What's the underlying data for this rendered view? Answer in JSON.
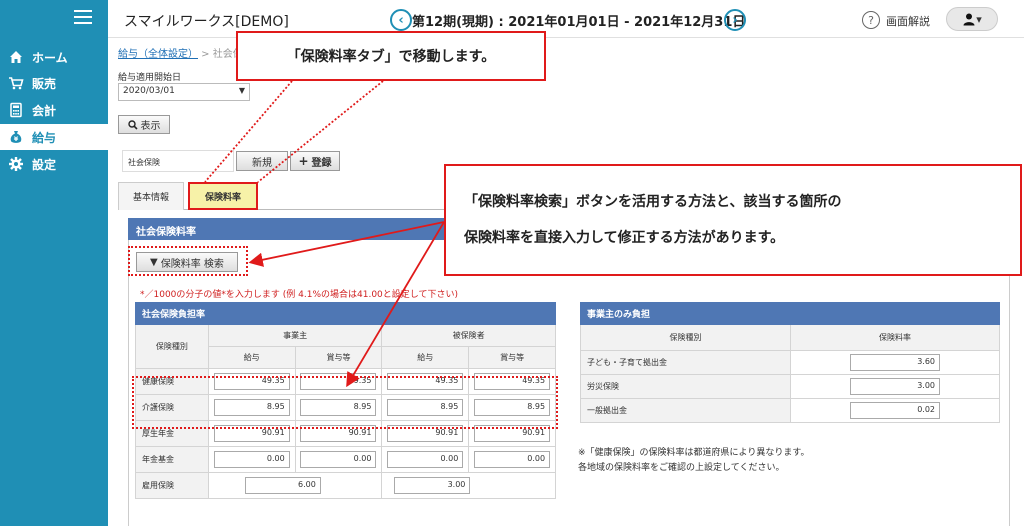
{
  "sidebar": {
    "items": [
      {
        "label": "ホーム",
        "icon": "home-icon"
      },
      {
        "label": "販売",
        "icon": "cart-icon"
      },
      {
        "label": "会計",
        "icon": "calculator-icon"
      },
      {
        "label": "給与",
        "icon": "money-bag-icon"
      },
      {
        "label": "設定",
        "icon": "gear-icon"
      }
    ],
    "active": "給与"
  },
  "header": {
    "company": "スマイルワークス[DEMO]",
    "period": "第12期(現期) : 2021年01月01日 - 2021年12月31日",
    "help_label": "画面解説"
  },
  "breadcrumb": {
    "link": "給与（全体設定）",
    "sep": " > ",
    "current": "社会保"
  },
  "filters": {
    "date_label": "給与適用開始日",
    "date_value": "2020/03/01",
    "show_button": "表示",
    "insurance_label": "社会保険",
    "new_button": "新規",
    "register_button": "登録"
  },
  "tabs": [
    {
      "label": "基本情報"
    },
    {
      "label": "保険料率"
    }
  ],
  "panel": {
    "title": "社会保険料率",
    "search_button": "保険料率 検索",
    "note": "*／1000の分子の値*を入力します (例 4.1%の場合は41.00と設定して下さい)"
  },
  "main_table": {
    "title": "社会保険負担率",
    "col_type": "保険種別",
    "group_employer": "事業主",
    "group_insured": "被保険者",
    "sub_salary": "給与",
    "sub_bonus": "賞与等",
    "rows": [
      {
        "label": "健康保険",
        "values": [
          "49.35",
          "49.35",
          "49.35",
          "49.35"
        ]
      },
      {
        "label": "介護保険",
        "values": [
          "8.95",
          "8.95",
          "8.95",
          "8.95"
        ]
      },
      {
        "label": "厚生年金",
        "values": [
          "90.91",
          "90.91",
          "90.91",
          "90.91"
        ]
      },
      {
        "label": "年金基金",
        "values": [
          "0.00",
          "0.00",
          "0.00",
          "0.00"
        ]
      },
      {
        "label": "雇用保険",
        "values": [
          "6.00",
          "",
          "3.00",
          ""
        ]
      }
    ]
  },
  "employer_table": {
    "title": "事業主のみ負担",
    "col_type": "保険種別",
    "col_rate": "保険料率",
    "rows": [
      {
        "label": "子ども・子育て拠出金",
        "value": "3.60"
      },
      {
        "label": "労災保険",
        "value": "3.00"
      },
      {
        "label": "一般拠出金",
        "value": "0.02"
      }
    ]
  },
  "note": {
    "line1": "※「健康保険」の保険料率は都道府県により異なります。",
    "line2": "各地域の保険料率をご確認の上設定してください。"
  },
  "callouts": {
    "tab": "「保険料率タブ」で移動します。",
    "method_line1": "「保険料率検索」ボタンを活用する方法と、該当する箇所の",
    "method_line2": "保険料率を直接入力して修正する方法があります。"
  },
  "colors": {
    "sidebar": "#1f8fb5",
    "header_blue": "#4f77b4",
    "callout_red": "#e01a1a",
    "tab_yellow": "#f7f2a8"
  }
}
